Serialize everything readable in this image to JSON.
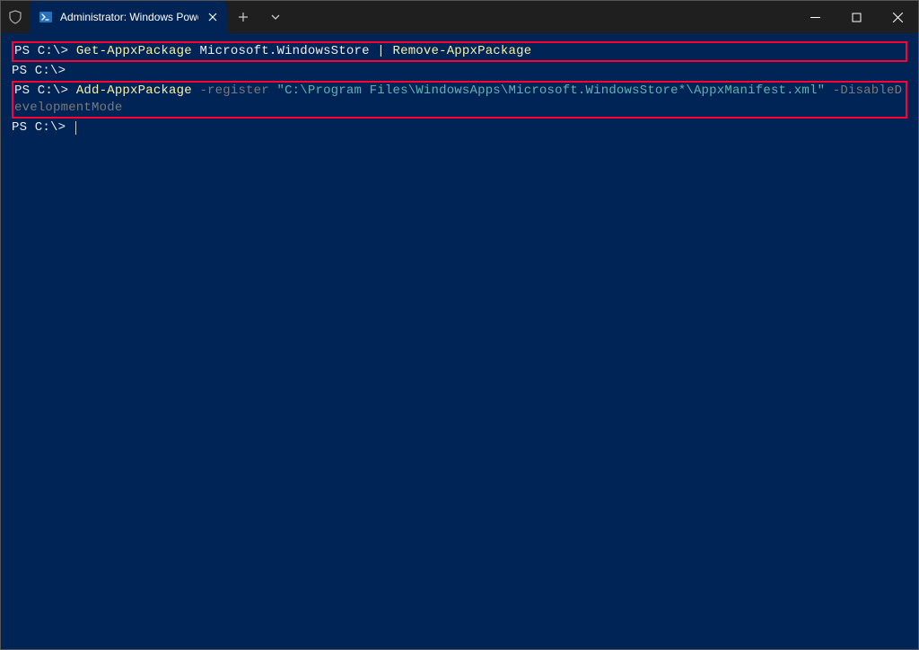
{
  "titlebar": {
    "tab_title": "Administrator: Windows Powe"
  },
  "terminal": {
    "line1_prompt": "PS C:\\> ",
    "line1_cmd": "Get-AppxPackage",
    "line1_arg": " Microsoft.WindowsStore ",
    "line1_pipe": "|",
    "line1_cmd2": " Remove-AppxPackage",
    "line2_prompt": "PS C:\\>",
    "line3_prompt": "PS C:\\> ",
    "line3_cmd": "Add-AppxPackage",
    "line3_flag1": " -register ",
    "line3_str": "\"C:\\Program Files\\WindowsApps\\Microsoft.WindowsStore*\\AppxManifest.xml\"",
    "line3_flag2": " -DisableDevelopmentMode",
    "line4_prompt": "PS C:\\> "
  }
}
